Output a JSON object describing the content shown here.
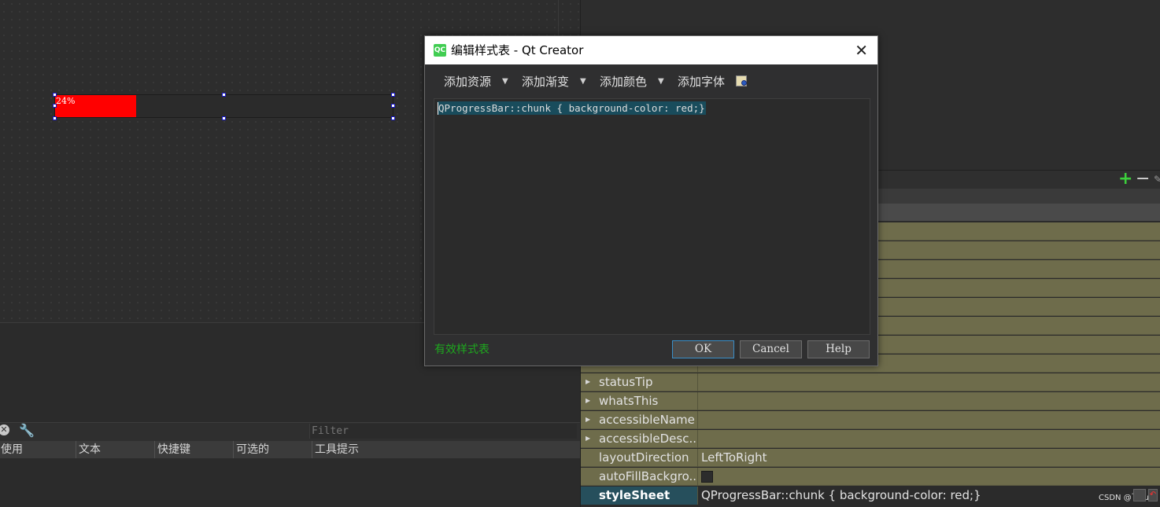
{
  "canvas": {
    "progress_bar": {
      "value_percent": 24,
      "text": "24%",
      "chunk_color": "#ff0000"
    }
  },
  "action_editor": {
    "filter_placeholder": "Filter",
    "columns": [
      "使用",
      "文本",
      "快捷键",
      "可选的",
      "工具提示"
    ]
  },
  "property_editor": {
    "rows": [
      {
        "name": "statusTip",
        "expandable": true,
        "value": ""
      },
      {
        "name": "whatsThis",
        "expandable": true,
        "value": ""
      },
      {
        "name": "accessibleName",
        "expandable": true,
        "value": ""
      },
      {
        "name": "accessibleDesc...",
        "expandable": true,
        "value": ""
      },
      {
        "name": "layoutDirection",
        "expandable": false,
        "value": "LeftToRight"
      },
      {
        "name": "autoFillBackgro...",
        "expandable": false,
        "value": "",
        "checkbox": true
      },
      {
        "name": "styleSheet",
        "expandable": false,
        "value": "QProgressBar::chunk { background-color: red;}",
        "selected": true
      }
    ],
    "plus_icon": "plus-icon",
    "minus_icon": "minus-icon"
  },
  "dialog": {
    "title": "编辑样式表 - Qt Creator",
    "app_icon_text": "QC",
    "toolbar": {
      "add_resource": "添加资源",
      "add_gradient": "添加渐变",
      "add_color": "添加颜色",
      "add_font": "添加字体"
    },
    "editor_text": "QProgressBar::chunk { background-color: red;}",
    "status": "有效样式表",
    "buttons": {
      "ok": "OK",
      "cancel": "Cancel",
      "help": "Help"
    },
    "status_color": "#1ea81e"
  },
  "watermark": "CSDN @飞yu"
}
